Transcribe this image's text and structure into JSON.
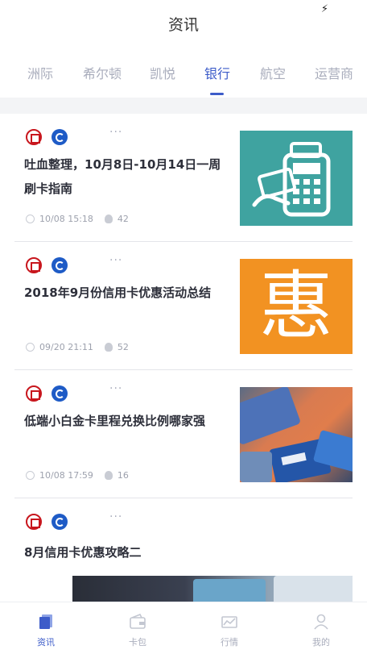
{
  "header": {
    "title": "资讯"
  },
  "tabs": [
    {
      "label": "洲际"
    },
    {
      "label": "希尔顿"
    },
    {
      "label": "凯悦"
    },
    {
      "label": "银行"
    },
    {
      "label": "航空"
    },
    {
      "label": "运营商"
    }
  ],
  "active_tab": "银行",
  "articles": [
    {
      "title": "吐血整理，10月8日-10月14日一周刷卡指南",
      "time": "10/08 15:18",
      "views": "42",
      "thumb_icon": "card-terminal-icon",
      "tags": [
        "icbc-logo",
        "ccb-logo"
      ]
    },
    {
      "title": "2018年9月份信用卡优惠活动总结",
      "time": "09/20 21:11",
      "views": "52",
      "thumb_text": "惠",
      "tags": [
        "icbc-logo",
        "ccb-logo"
      ]
    },
    {
      "title": "低端小白金卡里程兑换比例哪家强",
      "time": "10/08 17:59",
      "views": "16",
      "thumb_icon": "credit-cards-photo",
      "tags": [
        "icbc-logo",
        "ccb-logo"
      ]
    },
    {
      "title": "8月信用卡优惠攻略二",
      "thumb_icon": "credit-cards-photo",
      "tags": [
        "icbc-logo",
        "ccb-logo"
      ]
    }
  ],
  "bottom_nav": [
    {
      "label": "资讯",
      "icon": "news-icon",
      "active": true
    },
    {
      "label": "卡包",
      "icon": "wallet-icon",
      "active": false
    },
    {
      "label": "行情",
      "icon": "market-icon",
      "active": false
    },
    {
      "label": "我的",
      "icon": "profile-icon",
      "active": false
    }
  ],
  "colors": {
    "accent": "#3d5cc9",
    "tab_inactive": "#a9adbc",
    "icbc_red": "#c8161d",
    "ccb_blue": "#1e5bc6"
  }
}
